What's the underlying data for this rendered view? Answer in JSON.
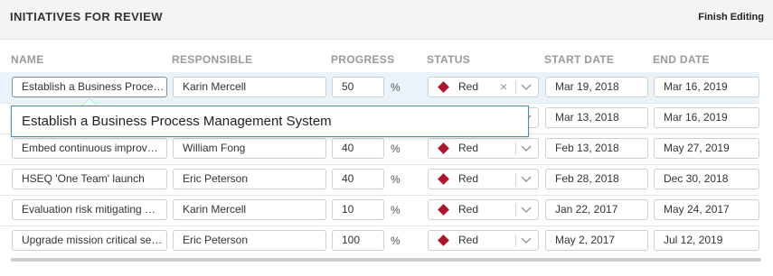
{
  "header": {
    "title": "INITIATIVES FOR REVIEW",
    "finish_label": "Finish Editing"
  },
  "columns": {
    "name": "NAME",
    "responsible": "RESPONSIBLE",
    "progress": "PROGRESS",
    "status": "STATUS",
    "start_date": "START DATE",
    "end_date": "END DATE"
  },
  "percent_sign": "%",
  "rows": [
    {
      "name": "Establish a Business Proce…",
      "responsible": "Karin Mercell",
      "progress": "50",
      "status": "Red",
      "start": "Mar 19, 2018",
      "end": "Mar 16, 2019"
    },
    {
      "name": "",
      "responsible": "",
      "progress": "",
      "status": "",
      "start": "Mar 13, 2018",
      "end": "Mar 16, 2019"
    },
    {
      "name": "Embed continuous improv…",
      "responsible": "William Fong",
      "progress": "40",
      "status": "Red",
      "start": "Feb 13, 2018",
      "end": "May 27, 2019"
    },
    {
      "name": "HSEQ 'One Team' launch",
      "responsible": "Eric Peterson",
      "progress": "40",
      "status": "Red",
      "start": "Feb 28, 2018",
      "end": "Dec 30, 2018"
    },
    {
      "name": "Evaluation risk mitigating …",
      "responsible": "Karin Mercell",
      "progress": "10",
      "status": "Red",
      "start": "Jan 22, 2017",
      "end": "May 24, 2017"
    },
    {
      "name": "Upgrade mission critical se…",
      "responsible": "Eric Peterson",
      "progress": "100",
      "status": "Red",
      "start": "May 2, 2017",
      "end": "Jul 12, 2019"
    }
  ],
  "popup": {
    "text": "Establish a Business Process Management System"
  },
  "status_color": "#b0142b"
}
